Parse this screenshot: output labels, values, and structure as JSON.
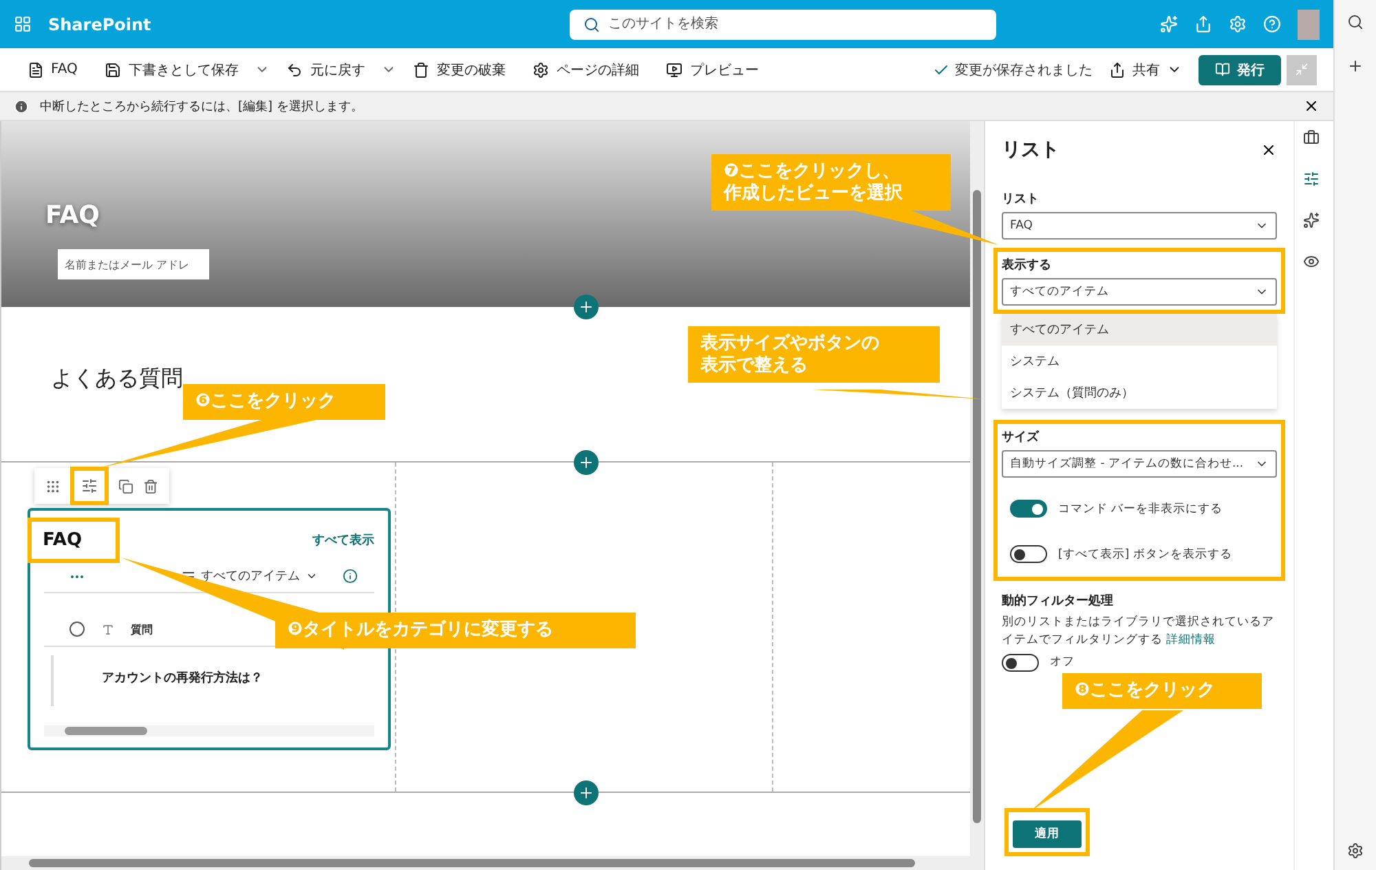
{
  "app_bar": {
    "brand": "SharePoint",
    "search": {
      "placeholder": "このサイトを検索"
    }
  },
  "command_bar": {
    "items": [
      {
        "kind": "page",
        "label": "FAQ"
      },
      {
        "kind": "save",
        "label": "下書きとして保存"
      },
      {
        "kind": "undo",
        "label": "元に戻す"
      },
      {
        "kind": "discard",
        "label": "変更の破棄"
      },
      {
        "kind": "details",
        "label": "ページの詳細"
      },
      {
        "kind": "preview",
        "label": "プレビュー"
      }
    ],
    "status": "変更が保存されました",
    "share": "共有",
    "publish": "発行"
  },
  "info_bar": {
    "message": "中断したところから続行するには、[編集] を選択します。"
  },
  "hero": {
    "title": "FAQ",
    "author": {
      "placeholder": "名前またはメール アドレ"
    }
  },
  "text_section": {
    "heading": "よくある質問"
  },
  "webpart": {
    "title": "FAQ",
    "see_all": "すべて表示",
    "view": "すべてのアイテム",
    "column": "質問",
    "rows": [
      "アカウントの再発行方法は？"
    ]
  },
  "panel": {
    "title": "リスト",
    "list_label": "リスト",
    "list_value": "FAQ",
    "view_label": "表示する",
    "view_value": "すべてのアイテム",
    "view_options": [
      {
        "label": "すべてのアイテム",
        "selected": true
      },
      {
        "label": "システム",
        "selected": false
      },
      {
        "label": "システム（質問のみ）",
        "selected": false
      }
    ],
    "size_label": "サイズ",
    "size_value": "自動サイズ調整 - アイテムの数に合わせ...",
    "toggles": [
      {
        "label": "コマンド バーを非表示にする",
        "on": true
      },
      {
        "label": "[すべて表示] ボタンを表示する",
        "on": false
      }
    ],
    "filter": {
      "title": "動的フィルター処理",
      "description": "別のリストまたはライブラリで選択されているアイテムでフィルタリングする",
      "link": "詳細情報",
      "on": false,
      "state_label": "オフ"
    },
    "apply": "適用"
  },
  "callouts": [
    {
      "lines": [
        "❻ここをクリック"
      ]
    },
    {
      "lines": [
        "❼ここをクリックし、",
        "作成したビューを選択"
      ]
    },
    {
      "lines": [
        "表示サイズやボタンの",
        "表示で整える"
      ]
    },
    {
      "lines": [
        "❽ここをクリック"
      ]
    },
    {
      "lines": [
        "❾タイトルをカテゴリに変更する"
      ]
    }
  ]
}
